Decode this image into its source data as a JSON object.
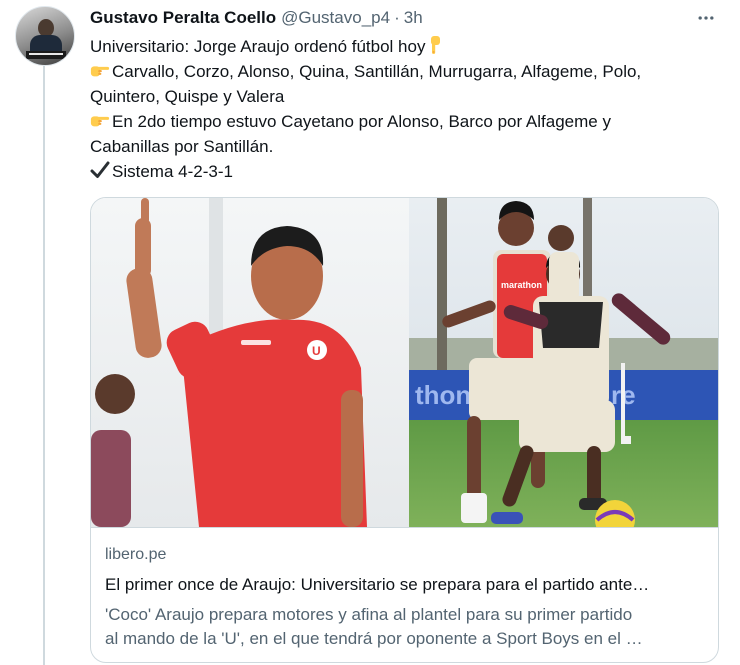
{
  "tweet": {
    "author_name": "Gustavo Peralta Coello",
    "handle": "@Gustavo_p4",
    "separator": "·",
    "time": "3h",
    "lines": [
      {
        "emoji": "",
        "text": "Universitario: Jorge Araujo ordenó fútbol hoy",
        "trailing_emoji": "pointing-down-hand"
      },
      {
        "emoji": "pointing-right-hand",
        "text": "Carvallo, Corzo, Alonso, Quina, Santillán, Murrugarra, Alfageme, Polo,"
      },
      {
        "emoji": "",
        "text": "Quintero, Quispe y Valera"
      },
      {
        "emoji": "pointing-right-hand",
        "text": "En 2do tiempo estuvo Cayetano por Alonso, Barco por Alfageme y"
      },
      {
        "emoji": "",
        "text": "Cabanillas por Santillán."
      },
      {
        "emoji": "check-mark",
        "text": "Sistema 4-2-3-1"
      }
    ]
  },
  "card": {
    "domain": "libero.pe",
    "title": "El primer once de Araujo: Universitario se prepara para el partido ante…",
    "description_lines": [
      "'Coco' Araujo prepara motores y afina al plantel para su primer partido",
      "al mando de la 'U', en el que tendrá por oponente a Sport Boys en el …"
    ],
    "image_board_text": "marathon"
  },
  "icons": {
    "more": "more-options-icon",
    "pointing_right": "pointing-right-hand-emoji",
    "pointing_down": "pointing-down-hand-emoji",
    "check": "check-mark-emoji"
  },
  "colors": {
    "text_primary": "#0f1419",
    "text_secondary": "#536471",
    "border": "#cfd9de",
    "jersey_red": "#e53a3a",
    "emoji_yellow": "#ffcc4d"
  }
}
